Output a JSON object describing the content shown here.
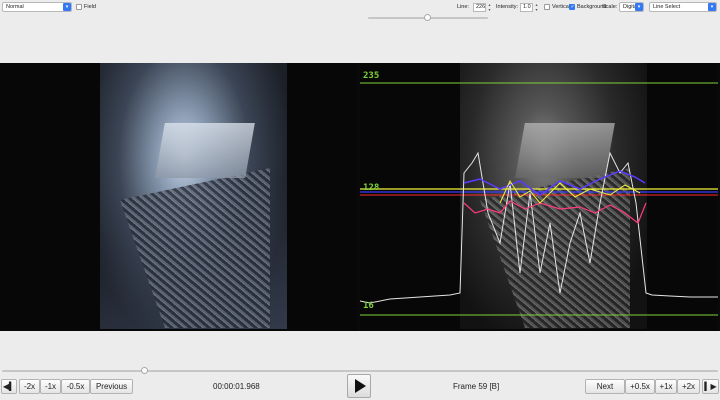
{
  "toolbar": {
    "mode_select": "Normal",
    "field_label": "Field",
    "line_label": "Line:",
    "line_value": "226",
    "intensity_label": "Intensity:",
    "intensity_value": "1.0",
    "vertical_label": "Vertical",
    "background_label": "Background",
    "scale_label": "Scale:",
    "scale_select": "Digital",
    "line_select": "Line Select",
    "field_checked": false,
    "vertical_checked": false,
    "background_checked": true,
    "top_slider_fraction": 0.5
  },
  "scope": {
    "labels": [
      "235",
      "128",
      "16"
    ]
  },
  "playback": {
    "timeline_fraction": 0.2,
    "timecode": "00:00:01.968",
    "frame_label": "Frame 59 [B]",
    "prev_buttons": [
      "-2x",
      "-1x",
      "-0.5x",
      "Previous"
    ],
    "next_buttons": [
      "Next",
      "+0.5x",
      "+1x",
      "+2x"
    ]
  },
  "colors": {
    "scope_green": "#7dd13b",
    "line_yellow": "#f2f23a",
    "line_blue": "#3b3bff",
    "line_red": "#ff2a2a",
    "accent": "#3478f6"
  },
  "icons": {
    "skip_back": "skip-back-icon",
    "skip_forward": "skip-forward-icon",
    "play": "play-icon"
  }
}
